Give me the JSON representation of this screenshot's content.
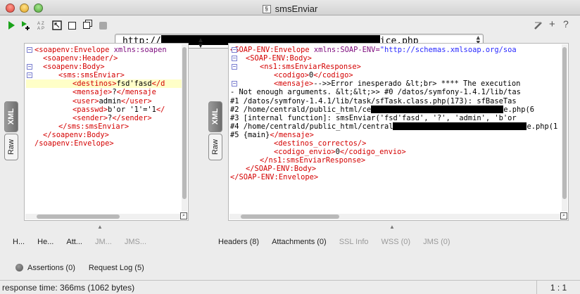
{
  "window": {
    "title": "smsEnviar"
  },
  "toolbar": {
    "url_prefix": "http://",
    "url_suffix": "ice.php"
  },
  "left_panel": {
    "tabs": [
      "XML",
      "Raw"
    ],
    "lines": [
      [
        [
          "tag",
          "<soapenv:Envelope "
        ],
        [
          "attr",
          "xmlns:soapen"
        ]
      ],
      [
        [
          "tag",
          "<soapenv:Header/>"
        ]
      ],
      [
        [
          "tag",
          "<soapenv:Body>"
        ]
      ],
      [
        [
          "tag",
          "<sms:smsEnviar>"
        ]
      ],
      [
        [
          "tag",
          "<destinos>"
        ],
        [
          "txt",
          "fsd'fasd"
        ],
        [
          "tag",
          "</d"
        ]
      ],
      [
        [
          "tag",
          "<mensaje>"
        ],
        [
          "txt",
          "?"
        ],
        [
          "tag",
          "</mensaje"
        ]
      ],
      [
        [
          "tag",
          "<user>"
        ],
        [
          "txt",
          "admin"
        ],
        [
          "tag",
          "</user>"
        ]
      ],
      [
        [
          "tag",
          "<passwd>"
        ],
        [
          "txt",
          "b'or '1'='1"
        ],
        [
          "tag",
          "</"
        ]
      ],
      [
        [
          "tag",
          "<sender>"
        ],
        [
          "txt",
          "?"
        ],
        [
          "tag",
          "</sender>"
        ]
      ],
      [
        [
          "tag",
          "</sms:smsEnviar>"
        ]
      ],
      [
        [
          "tag",
          "</soapenv:Body>"
        ]
      ],
      [
        [
          "tag",
          "/soapenv:Envelope>"
        ]
      ]
    ]
  },
  "right_panel": {
    "tabs": [
      "XML",
      "Raw"
    ],
    "lines": [
      [
        [
          "tag",
          "<SOAP-ENV:Envelope "
        ],
        [
          "attr",
          "xmlns:SOAP-ENV="
        ],
        [
          "val",
          "\"http://schemas.xmlsoap.org/soa"
        ]
      ],
      [
        [
          "tag",
          "<SOAP-ENV:Body>"
        ]
      ],
      [
        [
          "tag",
          "<ns1:smsEnviarResponse>"
        ]
      ],
      [
        [
          "tag",
          "<codigo>"
        ],
        [
          "txt",
          "0"
        ],
        [
          "tag",
          "</codigo>"
        ]
      ],
      [
        [
          "tag",
          "<mensaje>"
        ],
        [
          "txt",
          "-->>Error inesperado &lt;br> **** The execution"
        ]
      ],
      [
        [
          "txt",
          "- Not enough arguments. &lt;&lt;>> #0 /datos/symfony-1.4.1/lib/tas"
        ]
      ],
      [
        [
          "txt",
          "#1 /datos/symfony-1.4.1/lib/task/sfTask.class.php(173): sfBaseTas"
        ]
      ],
      [
        [
          "txt",
          "#2 /home/centrald/public_html/ce"
        ],
        [
          "redact",
          ""
        ],
        [
          "txt",
          "e.php(6"
        ]
      ],
      [
        [
          "txt",
          "#3 [internal function]: smsEnviar('fsd'fasd', '?', 'admin', 'b'or"
        ]
      ],
      [
        [
          "txt",
          "#4 /home/centrald/public_html/central"
        ],
        [
          "redact",
          ""
        ],
        [
          "txt",
          "e.php(1"
        ]
      ],
      [
        [
          "txt",
          "#5 {main}"
        ],
        [
          "tag",
          "</mensaje>"
        ]
      ],
      [
        [
          "tag",
          "<destinos_correctos/>"
        ]
      ],
      [
        [
          "tag",
          "<codigo_envio>"
        ],
        [
          "txt",
          "0"
        ],
        [
          "tag",
          "</codigo_envio>"
        ]
      ],
      [
        [
          "tag",
          "</ns1:smsEnviarResponse>"
        ]
      ],
      [
        [
          "tag",
          "</SOAP-ENV:Body>"
        ]
      ],
      [
        [
          "tag",
          "</SOAP-ENV:Envelope>"
        ]
      ]
    ]
  },
  "left_bottom_tabs": [
    "H...",
    "He...",
    "Att...",
    "JM...",
    "JMS..."
  ],
  "right_bottom_tabs": [
    "Headers (8)",
    "Attachments (0)",
    "SSL Info",
    "WSS (0)",
    "JMS (0)"
  ],
  "assertions": {
    "assertions_label": "Assertions (0)",
    "request_log_label": "Request Log (5)"
  },
  "status": {
    "response_time": "response time: 366ms (1062 bytes)",
    "cursor_pos": "1 : 1"
  }
}
